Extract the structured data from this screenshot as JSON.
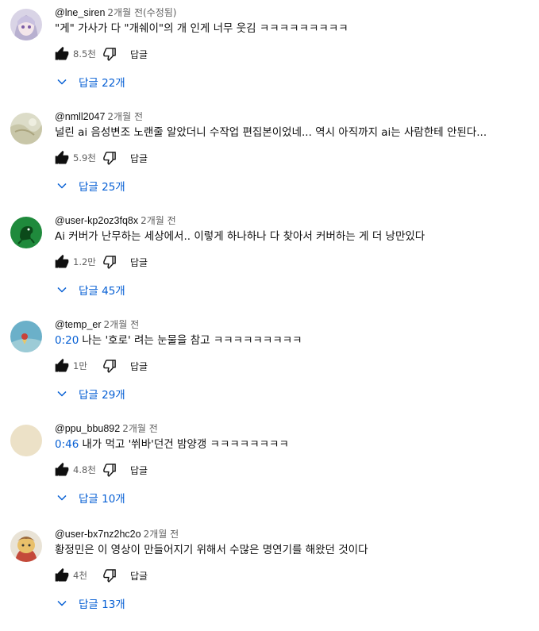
{
  "labels": {
    "reply": "답글"
  },
  "comments": [
    {
      "author": "@lne_siren",
      "time": "2개월 전(수정됨)",
      "timestamp": "",
      "text": "\"게\" 가사가 다 \"개쉐이\"의 개 인게 너무 웃김 ㅋㅋㅋㅋㅋㅋㅋㅋㅋ",
      "likes": "8.5천",
      "replies_label": "답글 22개"
    },
    {
      "author": "@nmll2047",
      "time": "2개월 전",
      "timestamp": "",
      "text": "널린 ai 음성변조 노랜줄 알았더니 수작업 편집본이었네... 역시 아직까지 ai는 사람한테 안된다...",
      "likes": "5.9천",
      "replies_label": "답글 25개"
    },
    {
      "author": "@user-kp2oz3fq8x",
      "time": "2개월 전",
      "timestamp": "",
      "text": "Ai 커버가 난무하는 세상에서.. 이렇게 하나하나 다 찾아서 커버하는 게 더 낭만있다",
      "likes": "1.2만",
      "replies_label": "답글 45개"
    },
    {
      "author": "@temp_er",
      "time": "2개월 전",
      "timestamp": "0:20",
      "text": "나는 '호로' 려는 눈물을 참고 ㅋㅋㅋㅋㅋㅋㅋㅋㅋ",
      "likes": "1만",
      "replies_label": "답글 29개"
    },
    {
      "author": "@ppu_bbu892",
      "time": "2개월 전",
      "timestamp": "0:46",
      "text": "내가 먹고 '쒸바'던건 밤양갱 ㅋㅋㅋㅋㅋㅋㅋㅋ",
      "likes": "4.8천",
      "replies_label": "답글 10개"
    },
    {
      "author": "@user-bx7nz2hc2o",
      "time": "2개월 전",
      "timestamp": "",
      "text": "황정민은 이 영상이 만들어지기 위해서 수많은 명연기를 해왔던 것이다",
      "likes": "4천",
      "replies_label": "답글 13개"
    }
  ],
  "colors": {
    "link": "#065fd4",
    "meta": "#606060",
    "text": "#0f0f0f"
  },
  "icons": [
    "thumbs-up-icon",
    "thumbs-down-icon",
    "chevron-down-icon"
  ]
}
